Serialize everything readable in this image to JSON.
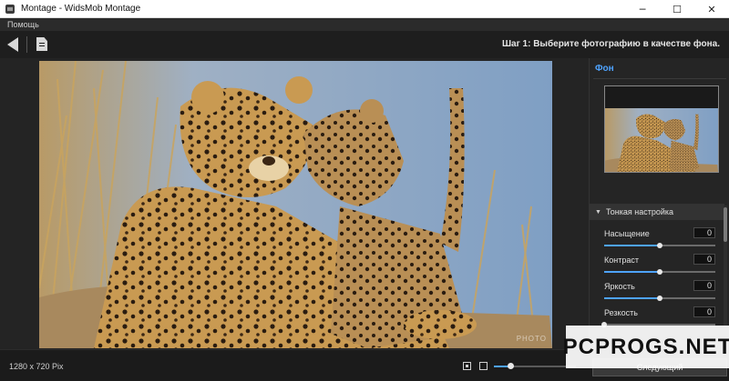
{
  "window": {
    "title": "Montage - WidsMob Montage",
    "minimize_icon": "─",
    "maximize_icon": "☐",
    "close_icon": "✕"
  },
  "menu": {
    "items": [
      {
        "label": "Помощь"
      }
    ]
  },
  "toolbar": {
    "step_text": "Шаг 1: Выберите фотографию в качестве фона."
  },
  "canvas": {
    "watermark": "PHOTO"
  },
  "sidebar": {
    "section_title": "Фон",
    "fine_tune": {
      "arrow": "▼",
      "label": "Тонкая настройка"
    },
    "adjustments": [
      {
        "label": "Насыщение",
        "value": "0",
        "level": 0.5
      },
      {
        "label": "Контраст",
        "value": "0",
        "level": 0.5
      },
      {
        "label": "Яркость",
        "value": "0",
        "level": 0.5
      },
      {
        "label": "Резкость",
        "value": "0",
        "level": 0.0
      }
    ]
  },
  "status": {
    "dimensions": "1280 x 720 Pix",
    "zoom_level": 0.2,
    "next_button": "Следующий"
  },
  "overlay": {
    "brand": "PCPROGS.NET"
  },
  "colors": {
    "accent": "#4ea3ff",
    "background": "#1e1e1e"
  }
}
